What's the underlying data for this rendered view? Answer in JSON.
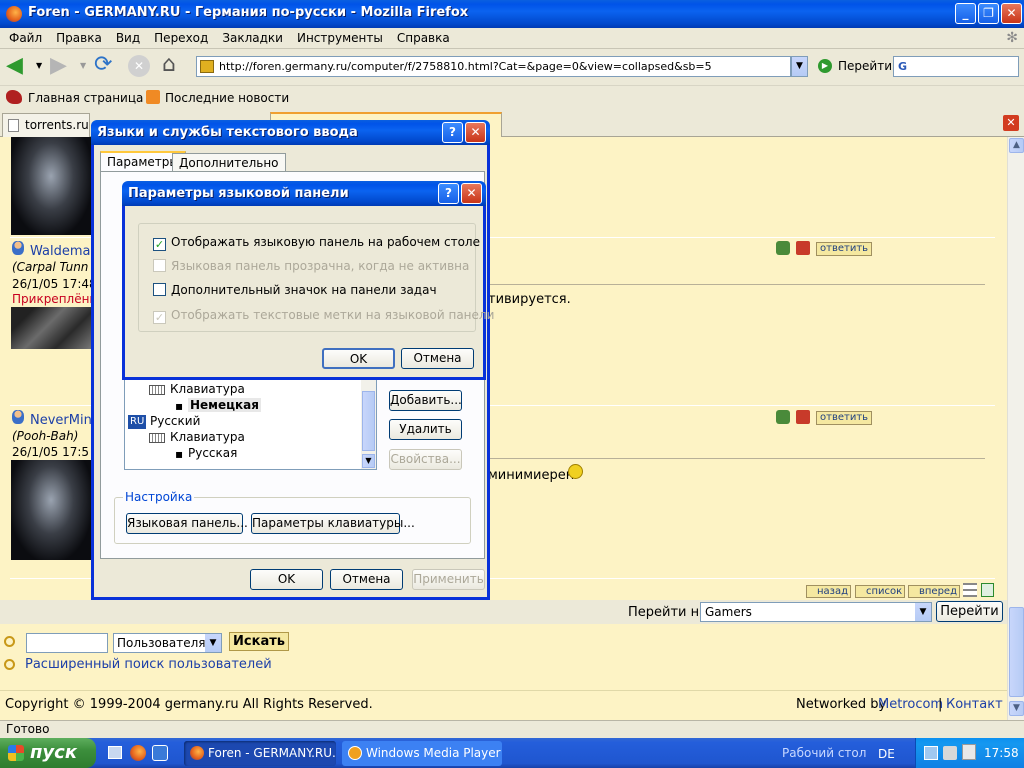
{
  "window": {
    "title": "Foren - GERMANY.RU - Германия по-русски - Mozilla Firefox",
    "controls": {
      "minimize": "_",
      "restore": "❐",
      "close": "✕"
    }
  },
  "menu": [
    "Файл",
    "Правка",
    "Вид",
    "Переход",
    "Закладки",
    "Инструменты",
    "Справка"
  ],
  "nav": {
    "url": "http://foren.germany.ru/computer/f/2758810.html?Cat=&page=0&view=collapsed&sb=5",
    "go_label": "Перейти",
    "search_value": "G"
  },
  "bookmarks": [
    "Главная страница ...",
    "Последние новости"
  ],
  "tabs": [
    "torrents.ru ::"
  ],
  "forum": {
    "posts": [
      {
        "author": "Waldemar",
        "title": "(Carpal Tunn",
        "date": "26/1/05 17:48",
        "attached": "Прикреплённ",
        "snippet": "тивируется.",
        "reply": "ответить"
      },
      {
        "author": "NeverMind",
        "title": "(Pooh-Bah)",
        "date": "26/1/05 17:5",
        "snippet": "минимиерен",
        "reply": "ответить"
      }
    ],
    "nav": {
      "back": "назад",
      "list": "список",
      "forward": "вперед"
    },
    "goto_label": "Перейти на",
    "goto_value": "Gamers",
    "goto_button": "Перейти",
    "search_select": "Пользователя",
    "search_button": "Искать",
    "advanced_search": "Расширенный поиск пользователей",
    "copyright": "Copyright © 1999-2004 germany.ru All Rights Reserved.",
    "networked": "Networked by",
    "metrocom": "Metrocom",
    "contact": "Контакт"
  },
  "status": "Готово",
  "dialog1": {
    "title": "Языки и службы текстового ввода",
    "tabs": [
      "Параметры",
      "Дополнительно"
    ],
    "tree": {
      "kbd1": "Клавиатура",
      "lang1_layout": "Немецкая",
      "lang2_code": "RU",
      "lang2": "Русский",
      "kbd2": "Клавиатура",
      "lang2_layout": "Русская"
    },
    "add": "Добавить...",
    "remove": "Удалить",
    "props": "Свойства...",
    "settings_group": "Настройка",
    "langbar_btn": "Языковая панель...",
    "kbd_btn": "Параметры клавиатуры...",
    "ok": "OK",
    "cancel": "Отмена",
    "apply": "Применить"
  },
  "dialog2": {
    "title": "Параметры языковой панели",
    "options": [
      {
        "label": "Отображать языковую панель на рабочем столе",
        "checked": true,
        "enabled": true
      },
      {
        "label": "Языковая панель прозрачна, когда не активна",
        "checked": false,
        "enabled": false
      },
      {
        "label": "Дополнительный значок на панели задач",
        "checked": false,
        "enabled": true
      },
      {
        "label": "Отображать текстовые метки на языковой панели",
        "checked": true,
        "enabled": false
      }
    ],
    "ok": "OK",
    "cancel": "Отмена"
  },
  "taskbar": {
    "start": "пуск",
    "tasks": [
      "Foren - GERMANY.RU...",
      "Windows Media Player"
    ],
    "desktop": "Рабочий стол",
    "lang": "DE",
    "time": "17:58"
  }
}
